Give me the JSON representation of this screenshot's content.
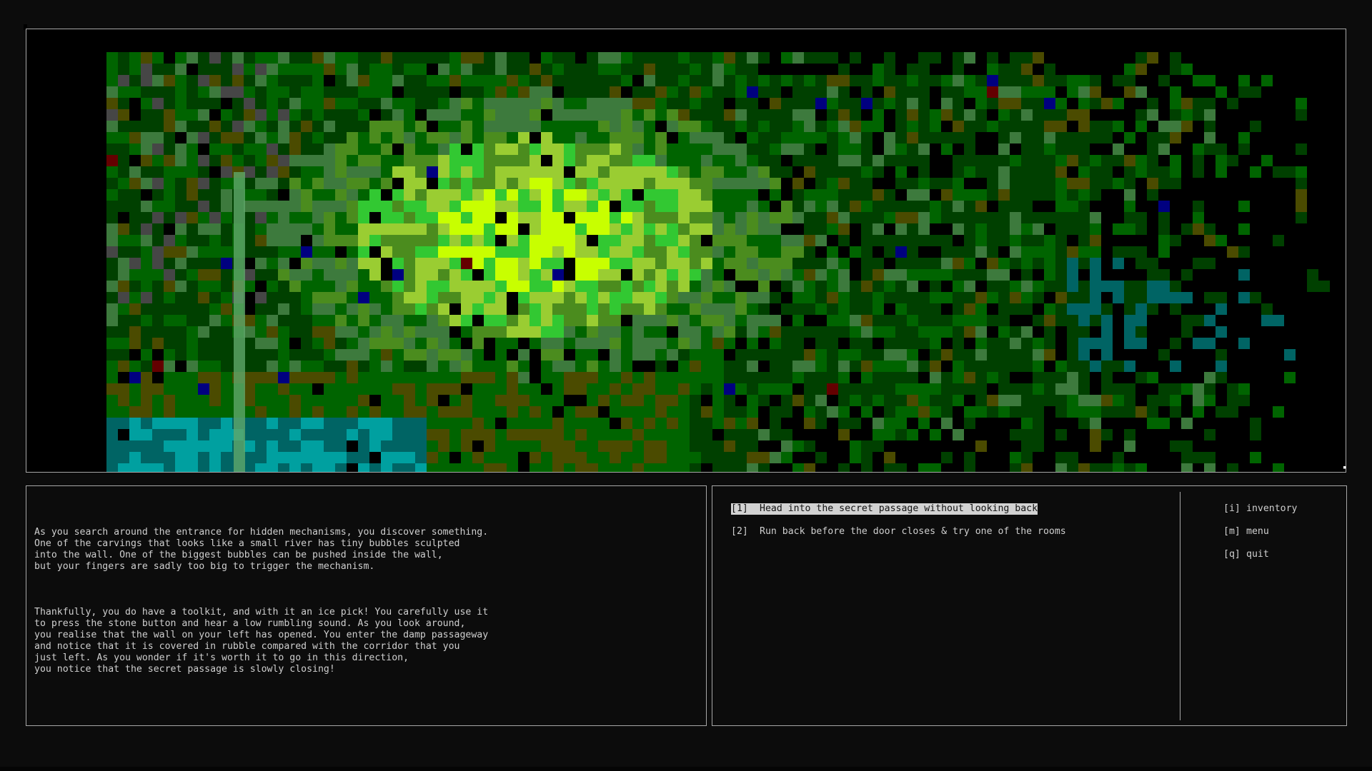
{
  "scene": {
    "description_icon": "pixel-art-cave-scene",
    "palette": {
      "background": "#000000",
      "dark_green": "#004000",
      "forest_green": "#006400",
      "mid_green": "#3d7a3d",
      "leaf_green": "#4b8c1e",
      "bright_green": "#32c832",
      "lime": "#9acd32",
      "yellow_lime": "#c8ff00",
      "olive": "#4b4b00",
      "teal": "#006464",
      "cyan": "#00a0a0",
      "grey": "#464646",
      "blue": "#000080",
      "red": "#640000"
    }
  },
  "story": {
    "paragraphs": [
      "As you search around the entrance for hidden mechanisms, you discover something.\nOne of the carvings that looks like a small river has tiny bubbles sculpted\ninto the wall. One of the biggest bubbles can be pushed inside the wall,\nbut your fingers are sadly too big to trigger the mechanism.",
      "Thankfully, you do have a toolkit, and with it an ice pick! You carefully use it\nto press the stone button and hear a low rumbling sound. As you look around,\nyou realise that the wall on your left has opened. You enter the damp passageway\nand notice that it is covered in rubble compared with the corridor that you\njust left. As you wonder if it's worth it to go in this direction,\nyou notice that the secret passage is slowly closing!"
    ]
  },
  "choices": [
    {
      "key": "[1]",
      "label": "Head into the secret passage without looking back",
      "selected": true
    },
    {
      "key": "[2]",
      "label": "Run back before the door closes & try one of the rooms",
      "selected": false
    }
  ],
  "commands": [
    {
      "key": "[i]",
      "label": "inventory"
    },
    {
      "key": "[m]",
      "label": "menu"
    },
    {
      "key": "[q]",
      "label": "quit"
    }
  ]
}
